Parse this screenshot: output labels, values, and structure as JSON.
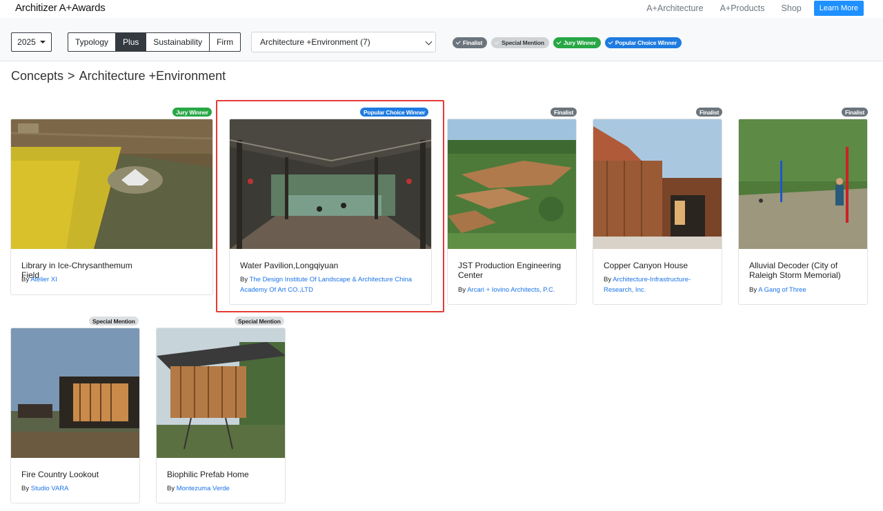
{
  "nav": {
    "logo_prefix": "Architizer",
    "logo_suffix": " A+Awards",
    "links": [
      "A+Architecture",
      "A+Products",
      "Shop"
    ],
    "cta": "Learn More"
  },
  "filters": {
    "year": "2025",
    "segments": [
      "Typology",
      "Plus",
      "Sustainability",
      "Firm"
    ],
    "active_segment": "Plus",
    "category_select": "Architecture +Environment (7)",
    "chips": [
      "Finalist",
      "Special Mention",
      "Jury Winner",
      "Popular Choice Winner"
    ]
  },
  "breadcrumb": {
    "parent": "Concepts",
    "sep": ">",
    "current": "Architecture +Environment"
  },
  "cards": [
    {
      "badge": "Jury Winner",
      "title": "Library in Ice-Chrysanthemum Field",
      "by": "By ",
      "firm": "Atelier XI"
    },
    {
      "badge": "Popular Choice Winner",
      "title": "Water Pavilion,Longqiyuan",
      "by": "By ",
      "firm": "The Design Institute Of Landscape & Architecture China Academy Of Art CO.,LTD"
    },
    {
      "badge": "Finalist",
      "title": "JST Production Engineering Center",
      "by": "By ",
      "firm": "Arcari + Iovino Architects, P.C."
    },
    {
      "badge": "Finalist",
      "title": "Copper Canyon House",
      "by": "By ",
      "firm": "Architecture-Infrastructure-Research, Inc."
    },
    {
      "badge": "Finalist",
      "title": "Alluvial Decoder (City of Raleigh Storm Memorial)",
      "by": "By ",
      "firm": "A Gang of Three"
    },
    {
      "badge": "Special Mention",
      "title": "Fire Country Lookout",
      "by": "By ",
      "firm": "Studio VARA"
    },
    {
      "badge": "Special Mention",
      "title": "Biophilic Prefab Home",
      "by": "By ",
      "firm": "Montezuma Verde"
    }
  ],
  "colors": {
    "finalist": "#6c757d",
    "special": "#dcdfe2",
    "jury": "#28a745",
    "popular": "#1e7be0",
    "link": "#1a73e8",
    "highlight": "#e53935"
  }
}
